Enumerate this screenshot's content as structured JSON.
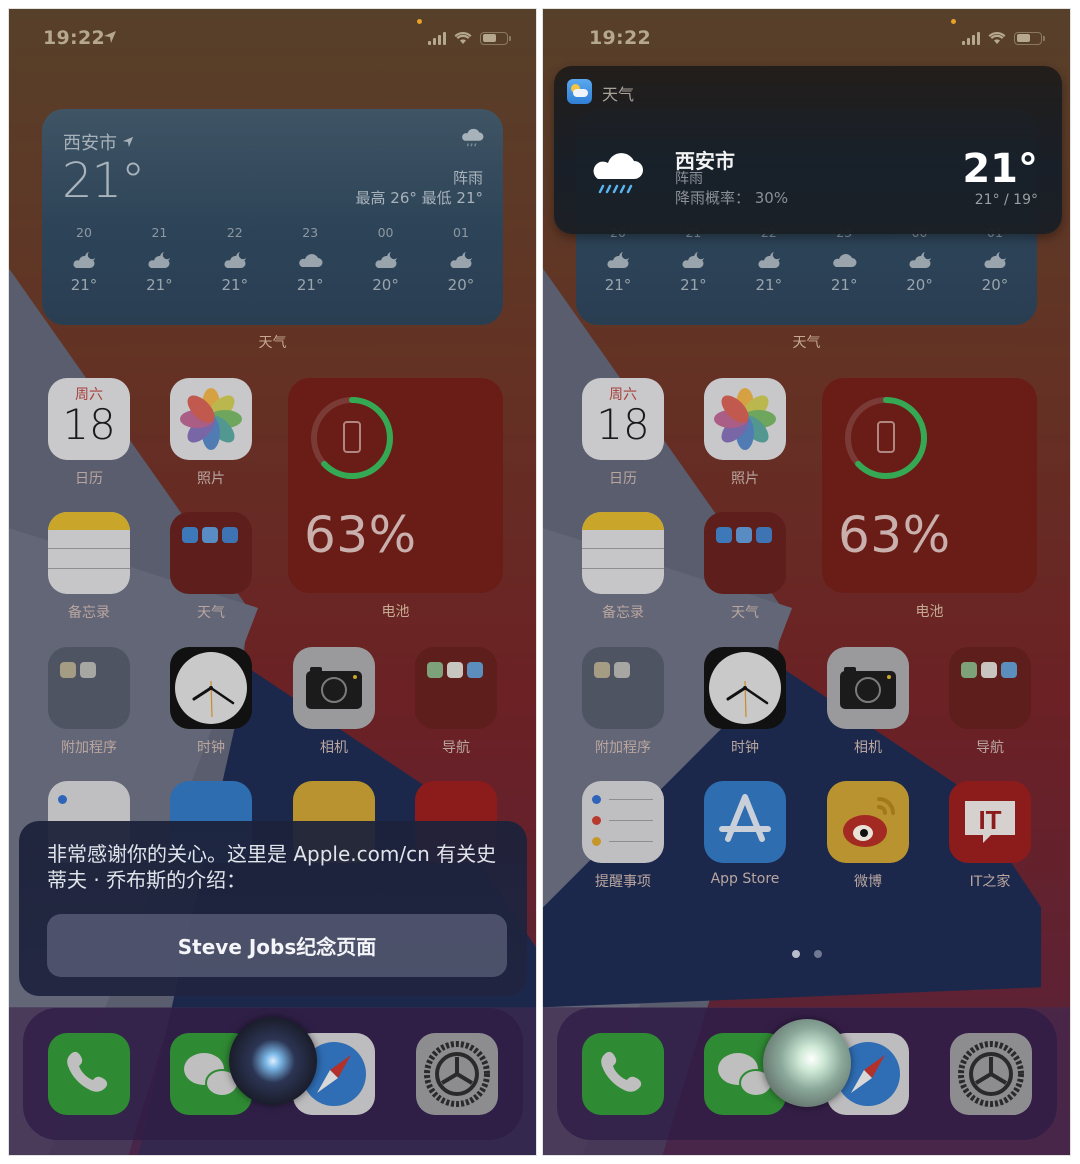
{
  "status_bar": {
    "time": "19:22",
    "colors": {
      "privacy_dot": "#e6a12a"
    }
  },
  "weather_widget": {
    "city": "西安市",
    "temperature": "21°",
    "condition": "阵雨",
    "high_low": "最高 26° 最低 21°",
    "label": "天气",
    "hourly": [
      {
        "hour": "20",
        "icon": "partly-cloudy-night-icon",
        "temp": "21°"
      },
      {
        "hour": "21",
        "icon": "partly-cloudy-night-icon",
        "temp": "21°"
      },
      {
        "hour": "22",
        "icon": "partly-cloudy-night-icon",
        "temp": "21°"
      },
      {
        "hour": "23",
        "icon": "cloud-icon",
        "temp": "21°"
      },
      {
        "hour": "00",
        "icon": "partly-cloudy-night-icon",
        "temp": "20°"
      },
      {
        "hour": "01",
        "icon": "partly-cloudy-night-icon",
        "temp": "20°"
      }
    ]
  },
  "calendar_icon": {
    "weekday": "周六",
    "day": "18"
  },
  "battery_widget": {
    "percent_text": "63%",
    "level": 0.63,
    "label": "电池",
    "ring_color": "#34a853"
  },
  "apps": {
    "calendar": "日历",
    "photos": "照片",
    "notes": "备忘录",
    "weather_folder": "天气",
    "utilities_folder": "附加程序",
    "clock": "时钟",
    "camera": "相机",
    "navigation_folder": "导航",
    "reminders": "提醒事项",
    "app_store": "App Store",
    "weibo": "微博",
    "ithome": "IT之家"
  },
  "dock": [
    "phone",
    "wechat",
    "safari",
    "settings"
  ],
  "siri_response": {
    "text": "非常感谢你的关心。这里是 Apple.com/cn 有关史蒂夫 · 乔布斯的介绍：",
    "button_label": "Steve Jobs纪念页面"
  },
  "siri_weather_snippet": {
    "app_name": "天气",
    "city": "西安市",
    "condition": "阵雨",
    "rain_chance": "降雨概率：  30%",
    "temperature": "21°",
    "high_low": "21° / 19°"
  },
  "page_indicator": {
    "pages": 2,
    "current": 1
  }
}
